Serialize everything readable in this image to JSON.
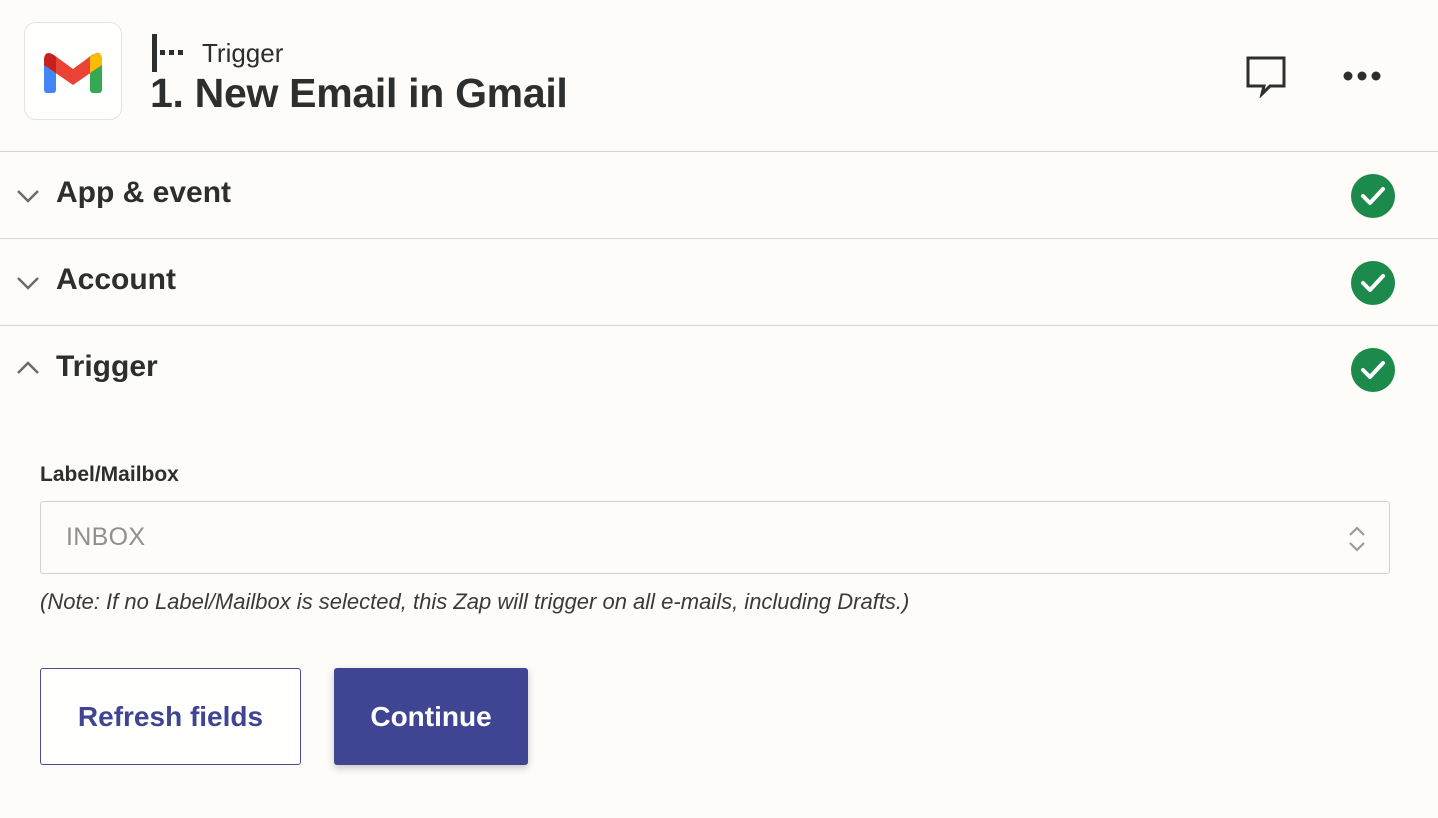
{
  "header": {
    "step_type": "Trigger",
    "title": "1. New Email in Gmail",
    "app_icon": "gmail-logo",
    "actions": [
      {
        "icon": "comment-icon"
      },
      {
        "icon": "more-horizontal-icon"
      }
    ]
  },
  "sections": [
    {
      "label": "App & event",
      "state": "collapsed",
      "status": "complete"
    },
    {
      "label": "Account",
      "state": "collapsed",
      "status": "complete"
    },
    {
      "label": "Trigger",
      "state": "expanded",
      "status": "complete"
    }
  ],
  "trigger_form": {
    "field_label": "Label/Mailbox",
    "field_value": "INBOX",
    "note": "(Note: If no Label/Mailbox is selected, this Zap will trigger on all e-mails, including Drafts.)",
    "refresh_label": "Refresh fields",
    "continue_label": "Continue"
  },
  "colors": {
    "background": "#fdfcf8",
    "primary": "#3f4592",
    "success": "#1c8a4a",
    "divider": "#d6d5d0"
  }
}
